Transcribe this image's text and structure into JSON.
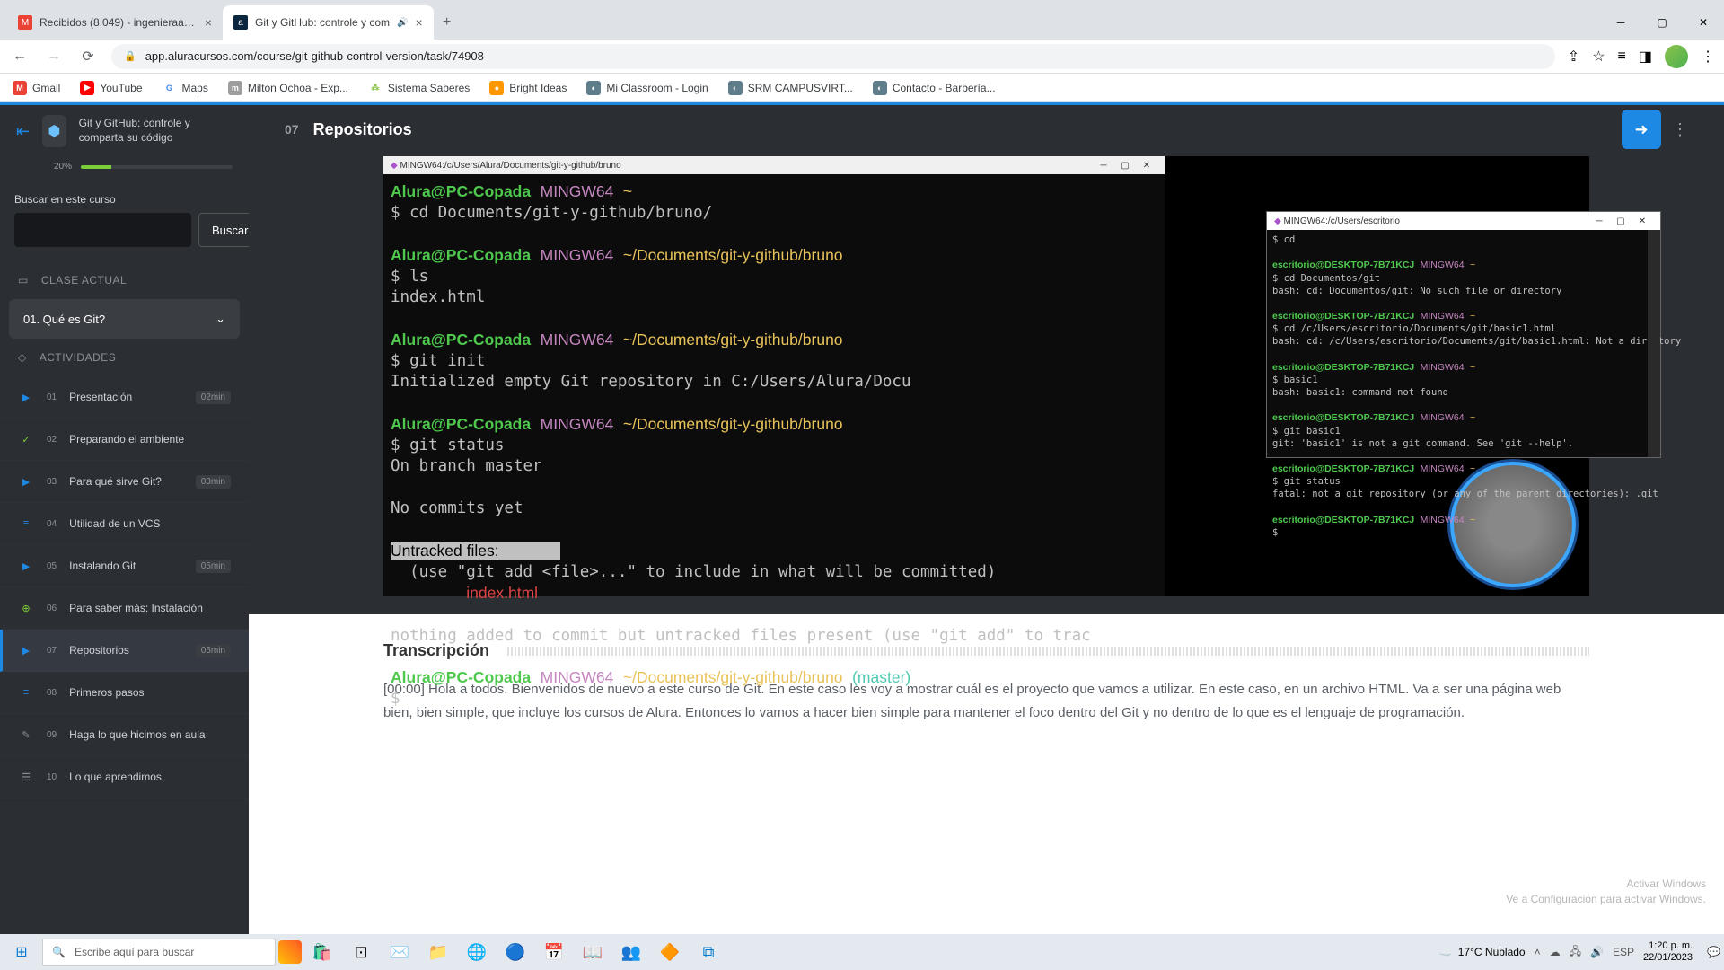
{
  "browser": {
    "tabs": [
      {
        "favicon": "M",
        "favicon_bg": "#ea4335",
        "title": "Recibidos (8.049) - ingenieraagric",
        "active": false,
        "audio": false
      },
      {
        "favicon": "a",
        "favicon_bg": "#0b2740",
        "title": "Git y GitHub: controle y com",
        "active": true,
        "audio": true
      }
    ],
    "url": "app.aluracursos.com/course/git-github-control-version/task/74908",
    "bookmarks": [
      {
        "ico": "M",
        "bg": "#ea4335",
        "label": "Gmail"
      },
      {
        "ico": "▶",
        "bg": "#ff0000",
        "label": "YouTube"
      },
      {
        "ico": "G",
        "bg": "#4285f4",
        "label": "Maps"
      },
      {
        "ico": "m",
        "bg": "#e0e0e0",
        "label": "Milton Ochoa - Exp..."
      },
      {
        "ico": "◆",
        "bg": "#8bc34a",
        "label": "Sistema Saberes"
      },
      {
        "ico": "●",
        "bg": "#ff9800",
        "label": "Bright Ideas"
      },
      {
        "ico": "◐",
        "bg": "#607d8b",
        "label": "Mi Classroom - Login"
      },
      {
        "ico": "◐",
        "bg": "#607d8b",
        "label": "SRM CAMPUSVIRT..."
      },
      {
        "ico": "◐",
        "bg": "#607d8b",
        "label": "Contacto - Barbería..."
      }
    ]
  },
  "sidebar": {
    "course_title": "Git y GitHub: controle y comparta su código",
    "progress": "20%",
    "search_placeholder": "Buscar en este curso",
    "search_btn": "Buscar",
    "section_current": "CLASE ACTUAL",
    "current_class": "01. Qué es Git?",
    "section_act": "ACTIVIDADES",
    "activities": [
      {
        "num": "01",
        "label": "Presentación",
        "dur": "02min",
        "ico": "▶",
        "col": "blue"
      },
      {
        "num": "02",
        "label": "Preparando el ambiente",
        "dur": "",
        "ico": "✓",
        "col": "green"
      },
      {
        "num": "03",
        "label": "Para qué sirve Git?",
        "dur": "03min",
        "ico": "▶",
        "col": "blue"
      },
      {
        "num": "04",
        "label": "Utilidad de un VCS",
        "dur": "",
        "ico": "≡",
        "col": "blue"
      },
      {
        "num": "05",
        "label": "Instalando Git",
        "dur": "05min",
        "ico": "▶",
        "col": "blue"
      },
      {
        "num": "06",
        "label": "Para saber más: Instalación",
        "dur": "",
        "ico": "⊕",
        "col": "green"
      },
      {
        "num": "07",
        "label": "Repositorios",
        "dur": "05min",
        "ico": "▶",
        "col": "blue",
        "active": true
      },
      {
        "num": "08",
        "label": "Primeros pasos",
        "dur": "",
        "ico": "≡",
        "col": "blue"
      },
      {
        "num": "09",
        "label": "Haga lo que hicimos en aula",
        "dur": "",
        "ico": "✎",
        "col": "grey"
      },
      {
        "num": "10",
        "label": "Lo que aprendimos",
        "dur": "",
        "ico": "☰",
        "col": "grey"
      }
    ]
  },
  "content": {
    "lesson_num": "07",
    "lesson_title": "Repositorios",
    "term_main_title": "MINGW64:/c/Users/Alura/Documents/git-y-github/bruno",
    "term_over_title": "MINGW64:/c/Users/escritorio",
    "transcript_title": "Transcripción",
    "transcript_body": "[00:00] Hola a todos. Bienvenidos de nuevo a este curso de Git. En este caso les voy a mostrar cuál es el proyecto que vamos a utilizar. En este caso, en un archivo HTML. Va a ser una página web bien, bien simple, que incluye los cursos de Alura. Entonces lo vamos a hacer bien simple para mantener el foco dentro del Git y no dentro de lo que es el lenguaje de programación."
  },
  "watermark": {
    "line1": "Activar Windows",
    "line2": "Ve a Configuración para activar Windows."
  },
  "taskbar": {
    "search": "Escribe aquí para buscar",
    "weather": "17°C  Nublado",
    "time": "1:20 p. m.",
    "date": "22/01/2023",
    "lang": "ESP"
  }
}
